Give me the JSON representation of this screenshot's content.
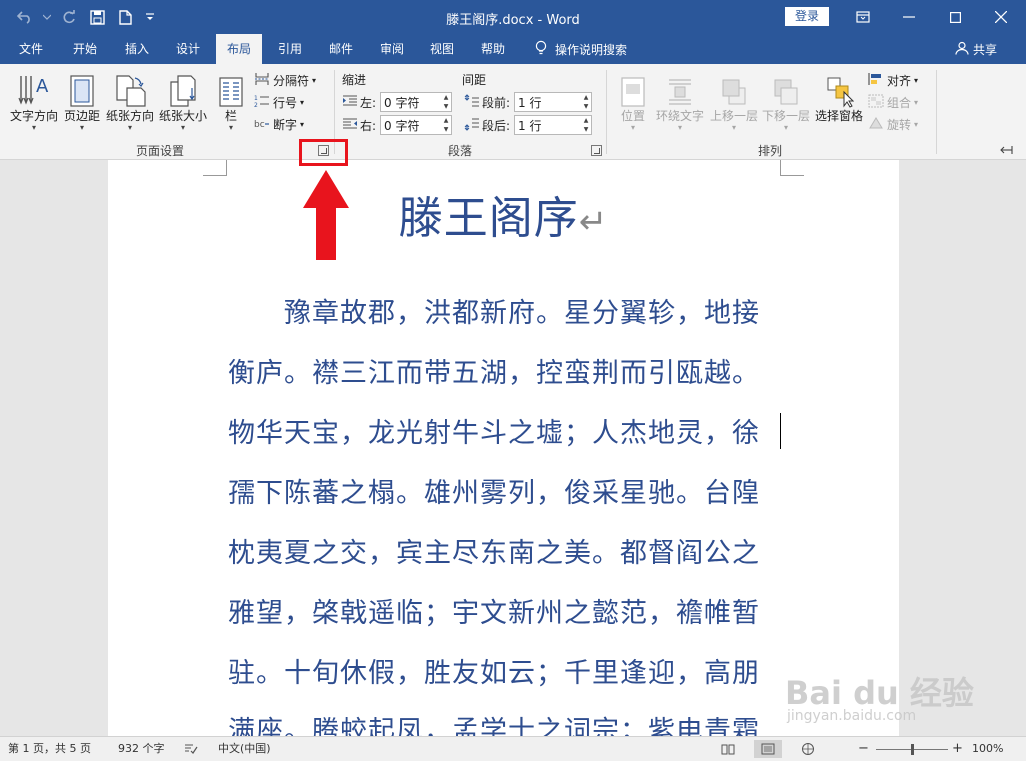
{
  "window": {
    "doc_title": "滕王阁序.docx  -  Word",
    "login_label": "登录"
  },
  "tabs": [
    "文件",
    "开始",
    "插入",
    "设计",
    "布局",
    "引用",
    "邮件",
    "审阅",
    "视图",
    "帮助"
  ],
  "active_tab": "布局",
  "tellme": "操作说明搜索",
  "share": "共享",
  "ribbon": {
    "page_setup": {
      "label": "页面设置",
      "text_direction": "文字方向",
      "margins": "页边距",
      "orientation": "纸张方向",
      "size": "纸张大小",
      "columns": "栏",
      "breaks": "分隔符",
      "line_numbers": "行号",
      "hyphenation": "断字"
    },
    "paragraph": {
      "label": "段落",
      "indent_title": "缩进",
      "spacing_title": "间距",
      "left_label": "左:",
      "right_label": "右:",
      "before_label": "段前:",
      "after_label": "段后:",
      "left_value": "0 字符",
      "right_value": "0 字符",
      "before_value": "1 行",
      "after_value": "1 行"
    },
    "arrange": {
      "label": "排列",
      "position": "位置",
      "wrap_text": "环绕文字",
      "bring_forward": "上移一层",
      "send_backward": "下移一层",
      "selection_pane": "选择窗格",
      "align": "对齐",
      "group": "组合",
      "rotate": "旋转"
    }
  },
  "document": {
    "heading": "滕王阁序",
    "heading_mark": "↵",
    "lines": [
      "　　豫章故郡，洪都新府。星分翼轸，地接",
      "衡庐。襟三江而带五湖，控蛮荆而引瓯越。",
      "物华天宝，龙光射牛斗之墟；人杰地灵，徐",
      "孺下陈蕃之榻。雄州雾列，俊采星驰。台隍",
      "枕夷夏之交，宾主尽东南之美。都督阎公之",
      "雅望，棨戟遥临；宇文新州之懿范，襜帷暂",
      "驻。十旬休假，胜友如云；千里逢迎，高朋",
      "满座。腾蛟起凤，孟学士之词宗；紫电青霜"
    ]
  },
  "watermark": {
    "main": "Bai du 经验",
    "sub": "jingyan.baidu.com"
  },
  "status": {
    "page": "第 1 页，共 5 页",
    "words": "932 个字",
    "language": "中文(中国)",
    "zoom_minus": "−",
    "zoom_plus": "+",
    "zoom": "100%",
    "zoom_level_percent": 100
  },
  "colors": {
    "accent": "#2b579a",
    "doc_text": "#2e4d8f",
    "annotation": "#e8141d"
  }
}
